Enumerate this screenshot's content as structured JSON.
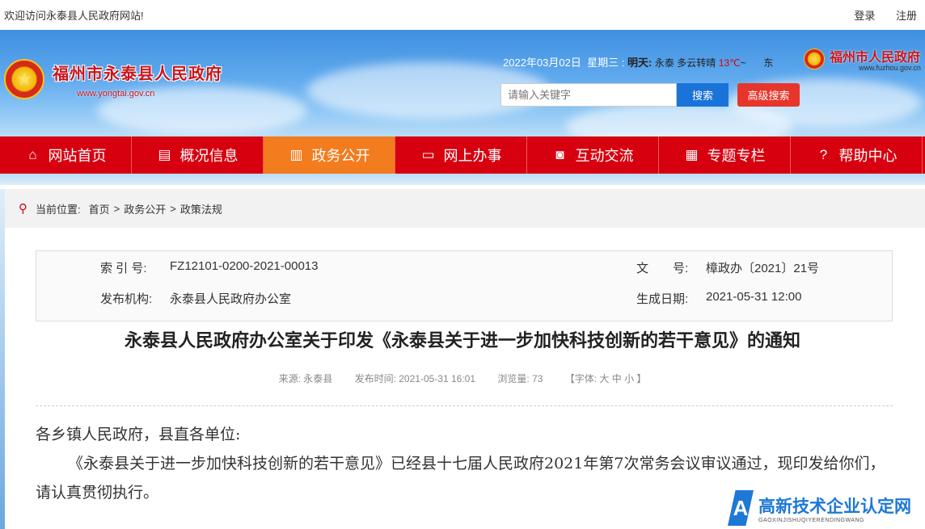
{
  "topbar": {
    "welcome": "欢迎访问永泰县人民政府网站!",
    "login": "登录",
    "register": "注册"
  },
  "header": {
    "site_title": "福州市永泰县人民政府",
    "site_url": "www.yongtai.gov.cn",
    "date": "2022年03月02日",
    "weekday": "星期三",
    "weather_label": "明天:",
    "weather_text": "永泰 多云转晴",
    "temp": "13℃",
    "temp_sep": "~",
    "wind": "东",
    "fz_title": "福州市人民政府",
    "fz_url": "www.fuzhou.gov.cn",
    "search_placeholder": "请输入关键字",
    "search_button": "搜索",
    "adv_search_button": "高级搜索"
  },
  "nav": {
    "items": [
      {
        "label": "网站首页",
        "icon": "home-icon"
      },
      {
        "label": "概况信息",
        "icon": "document-icon"
      },
      {
        "label": "政务公开",
        "icon": "folder-icon"
      },
      {
        "label": "网上办事",
        "icon": "monitor-icon"
      },
      {
        "label": "互动交流",
        "icon": "chat-icon"
      },
      {
        "label": "专题专栏",
        "icon": "grid-icon"
      },
      {
        "label": "帮助中心",
        "icon": "help-icon"
      }
    ],
    "active_index": 2
  },
  "breadcrumb": {
    "label": "当前位置:",
    "items": [
      "首页",
      "政务公开",
      "政策法规"
    ],
    "sep": ">"
  },
  "meta": {
    "index_label": "索 引 号:",
    "index_value": "FZ12101-0200-2021-00013",
    "doc_label": "文　　号:",
    "doc_value": "樟政办〔2021〕21号",
    "org_label": "发布机构:",
    "org_value": "永泰县人民政府办公室",
    "date_label": "生成日期:",
    "date_value": "2021-05-31 12:00"
  },
  "article": {
    "title": "永泰县人民政府办公室关于印发《永泰县关于进一步加快科技创新的若干意见》的通知",
    "source": "来源: 永泰县",
    "published": "发布时间: 2021-05-31 16:01",
    "views": "浏览量: 73",
    "font_label": "【字体: 大 中 小 】",
    "salutation": "各乡镇人民政府，县直各单位:",
    "paragraph": "《永泰县关于进一步加快科技创新的若干意见》已经县十七届人民政府2021年第7次常务会议审议通过，现印发给你们，请认真贯彻执行。"
  },
  "watermark": {
    "title": "高新技术企业认定网",
    "sub": "GAOXINJISHUQIYERENDINGWANG",
    "letter": "A"
  },
  "colors": {
    "nav_red": "#d7000f",
    "nav_active": "#f27c1e",
    "search_blue": "#1a73d9",
    "adv_red": "#e8352b",
    "title_red": "#c8161d"
  }
}
